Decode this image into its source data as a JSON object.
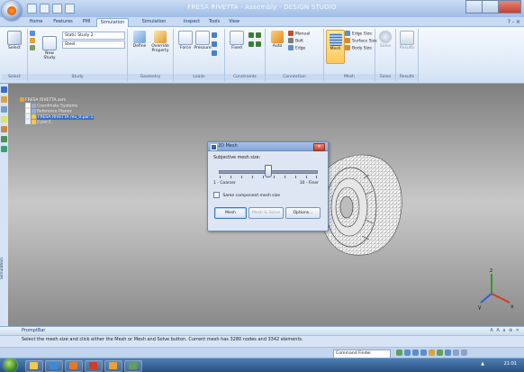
{
  "window": {
    "title": "FRESA RIVETTA - Assembly - DESIGN STUDIO",
    "help": "? - ×"
  },
  "tabs": [
    "Home",
    "Features",
    "PMI",
    "Simulation",
    "Simulation Geometry",
    "Inspect",
    "Tools",
    "View"
  ],
  "active_tab": "Simulation",
  "ribbon": {
    "select": {
      "label": "Select",
      "group": "Select"
    },
    "study": {
      "combo1": "Static Study 2",
      "combo2": "Steel",
      "new_study": "New Study",
      "group": "Study"
    },
    "geometry": {
      "define": "Define",
      "override": "Override Property",
      "group": "Geometry"
    },
    "loads": {
      "force": "Force",
      "pressure": "Pressure",
      "group": "Loads"
    },
    "constraints": {
      "fixed": "Fixed",
      "group": "Constraints"
    },
    "connection": {
      "auto": "Auto",
      "manual": "Manual",
      "bolt": "Bolt",
      "edge": "Edge",
      "group": "Connection"
    },
    "mesh": {
      "mesh": "Mesh",
      "edge_size": "Edge Size",
      "surface_size": "Surface Size",
      "body_size": "Body Size",
      "group": "Mesh"
    },
    "solve": {
      "solve": "Solve",
      "group": "Solve"
    },
    "results": {
      "results": "Results",
      "group": "Results"
    }
  },
  "left_strip": {
    "label": "Simulation"
  },
  "tree": [
    {
      "label": "FRESA RIVETTA.asm",
      "level": 0,
      "selected": false
    },
    {
      "label": "Coordinate Systems",
      "level": 1,
      "selected": false
    },
    {
      "label": "Reference Planes",
      "level": 1,
      "selected": false
    },
    {
      "label": "FRESA RIVETTA rev_0.par:1",
      "level": 1,
      "selected": true
    },
    {
      "label": "2.par:1",
      "level": 1,
      "selected": false
    }
  ],
  "dialog": {
    "title": "2D Mesh",
    "close": "×",
    "mesh_size_label": "Subjective mesh size:",
    "slider_value": 0.5,
    "coarser_label": "1 - Coarser",
    "finer_label": "10 - Finer",
    "same_mesh_label": "Same component mesh size",
    "same_mesh_checked": false,
    "buttons": {
      "mesh": "Mesh",
      "mesh_solve": "Mesh & Solve",
      "options": "Options..."
    }
  },
  "triad": {
    "x": "x",
    "y": "y",
    "z": "z"
  },
  "prompt": {
    "title": "PromptBar",
    "tools": "A A a ⊕ ✕",
    "text": "Select the mesh size and click either the Mesh or Mesh and Solve button. Current mesh has 3280 nodes and 3342 elements."
  },
  "status": {
    "command_finder": "Command Finder"
  },
  "taskbar": {
    "clock": "21:01",
    "tray_arrow": "▲"
  }
}
